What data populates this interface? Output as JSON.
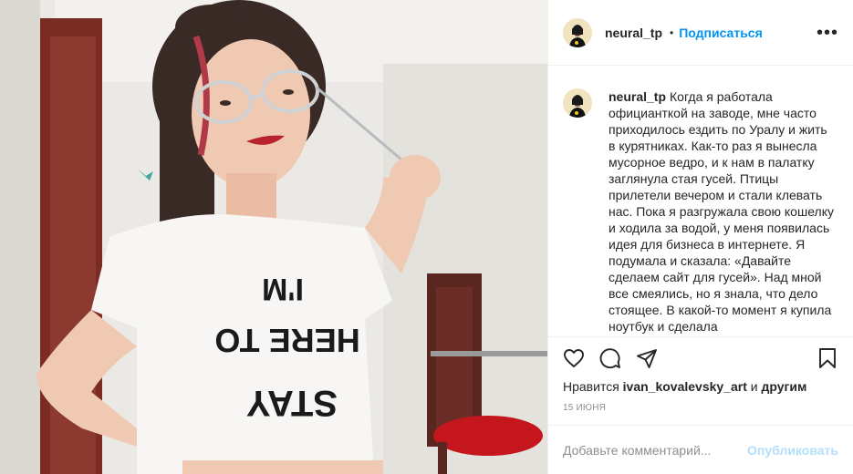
{
  "post": {
    "username": "neural_tp",
    "dot": "•",
    "follow_label": "Подписаться",
    "more_label": "•••",
    "caption_user": "neural_tp",
    "caption_text": "Когда я работала официанткой на заводе, мне часто приходилось ездить по Уралу и жить в курятниках. Как-то раз я вынесла мусорное ведро, и к нам в палатку заглянула стая гусей. Птицы прилетели вечером и стали клевать нас. Пока я разгружала свою кошелку и ходила за водой, у меня появилась идея для бизнеса в интернете. Я подумала и сказала: «Давайте сделаем сайт для гусей». Над мной все смеялись, но я знала, что дело стоящее. В какой-то момент я купила ноутбук и сделала",
    "likes_prefix": "Нравится ",
    "likes_user": "ivan_kovalevsky_art",
    "likes_and": " и ",
    "likes_others": "другим",
    "date": "15 июня",
    "comment_placeholder": "Добавьте комментарий...",
    "publish_label": "Опубликовать"
  },
  "photo": {
    "shirt_lines": [
      "I'M",
      "HERE TO",
      "STAY"
    ]
  },
  "icons": [
    "heart-icon",
    "comment-icon",
    "share-icon",
    "bookmark-icon"
  ],
  "colors": {
    "accent": "#0095f6",
    "publish_disabled": "#b2dffc",
    "text": "#262626",
    "muted": "#8e8e8e",
    "divider": "#efefef"
  }
}
